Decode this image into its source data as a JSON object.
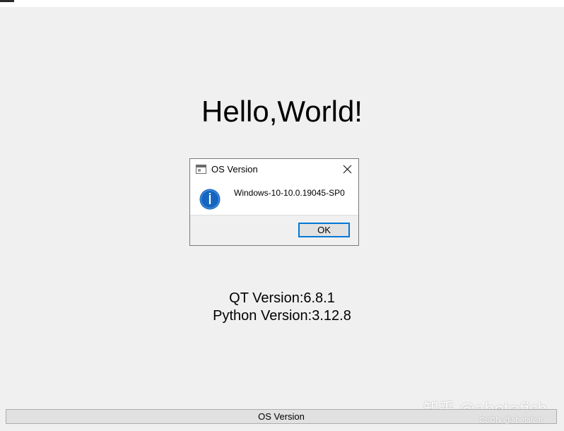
{
  "main": {
    "greeting": "Hello,World!",
    "qt_version": "QT Version:6.8.1",
    "python_version": "Python Version:3.12.8",
    "os_button_label": "OS Version"
  },
  "dialog": {
    "title": "OS Version",
    "message": "Windows-10-10.0.19045-SP0",
    "ok_label": "OK",
    "icon": "info-icon",
    "accent": "#0078d7"
  },
  "watermark": {
    "primary": "知乎 @abetafish",
    "secondary": "CSDN @abetafish"
  },
  "colors": {
    "background": "#f0f0f0",
    "info_icon": "#1565c0"
  }
}
